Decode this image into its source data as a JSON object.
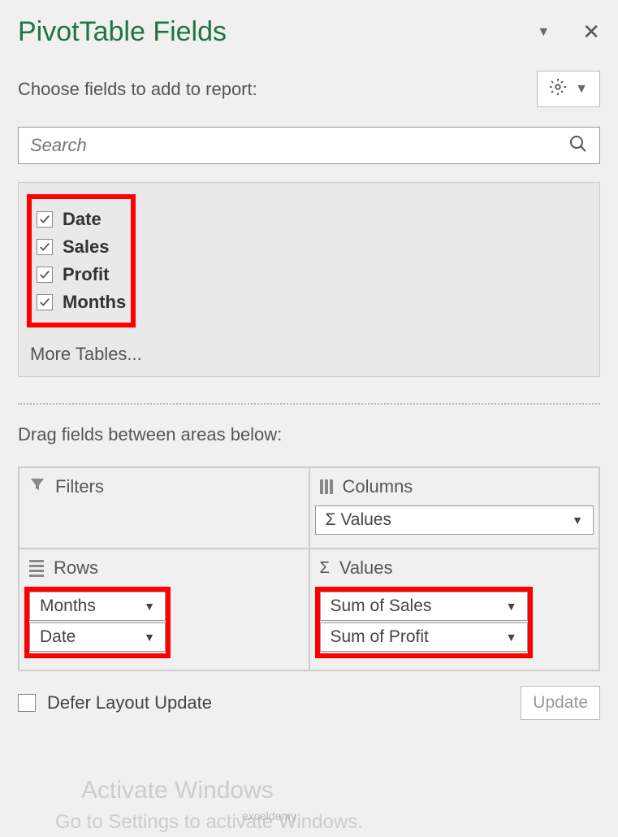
{
  "title": "PivotTable Fields",
  "subheader": "Choose fields to add to report:",
  "search": {
    "placeholder": "Search"
  },
  "fields": [
    {
      "label": "Date",
      "checked": true
    },
    {
      "label": "Sales",
      "checked": true
    },
    {
      "label": "Profit",
      "checked": true
    },
    {
      "label": "Months",
      "checked": true
    }
  ],
  "more_tables": "More Tables...",
  "drag_text": "Drag fields between areas below:",
  "areas": {
    "filters": {
      "title": "Filters"
    },
    "columns": {
      "title": "Columns",
      "items": [
        "Σ Values"
      ]
    },
    "rows": {
      "title": "Rows",
      "items": [
        "Months",
        "Date"
      ]
    },
    "values": {
      "title": "Values",
      "items": [
        "Sum of Sales",
        "Sum of Profit"
      ]
    }
  },
  "defer": "Defer Layout Update",
  "update_btn": "Update",
  "watermark": "Activate Windows",
  "watermark_sub": "Go to Settings to activate Windows.",
  "logo": "exceldemy"
}
